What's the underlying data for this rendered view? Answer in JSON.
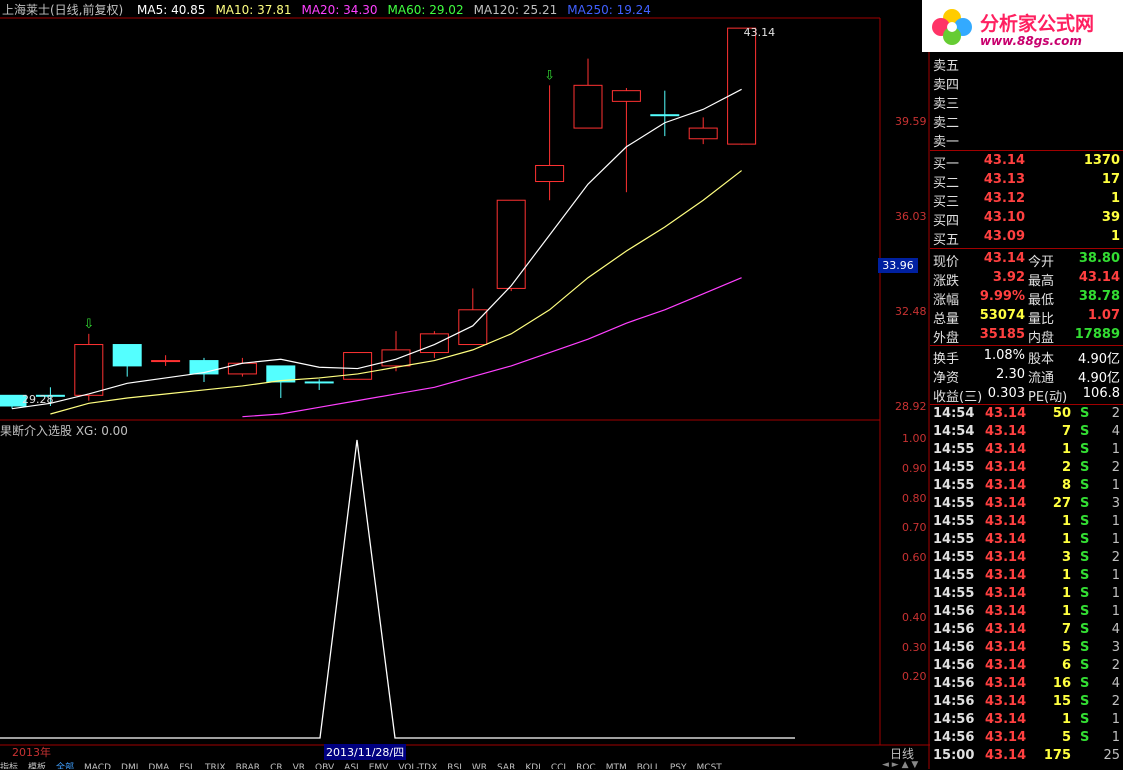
{
  "header": {
    "stock": "上海莱士(日线,前复权)",
    "ma": [
      {
        "label": "MA5: 40.85",
        "color": "#ffffff"
      },
      {
        "label": "MA10: 37.81",
        "color": "#ffff80"
      },
      {
        "label": "MA20: 34.30",
        "color": "#ff40ff"
      },
      {
        "label": "MA60: 29.02",
        "color": "#40ff40"
      },
      {
        "label": "MA120: 25.21",
        "color": "#c0c0c0"
      },
      {
        "label": "MA250: 19.24",
        "color": "#4060ff"
      }
    ]
  },
  "indicator": {
    "title": "果断介入选股 XG: 0.00",
    "date_label": "2013/11/28/四",
    "year_label": "2013年",
    "period": "日线"
  },
  "chart_data": [
    {
      "type": "candlestick",
      "title": "上海莱士(日线,前复权)",
      "yticks": [
        39.59,
        36.03,
        32.48,
        28.92
      ],
      "current_price_tag": 33.96,
      "annotations": [
        {
          "text": "43.14"
        },
        {
          "text": "29.28"
        }
      ],
      "candles": [
        {
          "o": 29.4,
          "c": 29.0,
          "h": 29.4,
          "l": 28.9,
          "up": false
        },
        {
          "o": 29.4,
          "c": 29.4,
          "h": 29.7,
          "l": 29.0,
          "up": false
        },
        {
          "o": 29.4,
          "c": 31.3,
          "h": 31.7,
          "l": 29.2,
          "up": true
        },
        {
          "o": 31.3,
          "c": 30.5,
          "h": 31.3,
          "l": 30.1,
          "up": false
        },
        {
          "o": 30.7,
          "c": 30.7,
          "h": 30.9,
          "l": 30.5,
          "up": true
        },
        {
          "o": 30.7,
          "c": 30.2,
          "h": 30.8,
          "l": 29.9,
          "up": false
        },
        {
          "o": 30.2,
          "c": 30.6,
          "h": 30.8,
          "l": 30.1,
          "up": true
        },
        {
          "o": 30.5,
          "c": 29.9,
          "h": 30.5,
          "l": 29.3,
          "up": false
        },
        {
          "o": 29.9,
          "c": 29.9,
          "h": 30.0,
          "l": 29.6,
          "up": false
        },
        {
          "o": 30.0,
          "c": 31.0,
          "h": 31.0,
          "l": 30.0,
          "up": true
        },
        {
          "o": 30.5,
          "c": 31.1,
          "h": 31.8,
          "l": 30.3,
          "up": true
        },
        {
          "o": 31.0,
          "c": 31.7,
          "h": 31.8,
          "l": 30.8,
          "up": true
        },
        {
          "o": 31.3,
          "c": 32.6,
          "h": 33.4,
          "l": 31.3,
          "up": true
        },
        {
          "o": 33.4,
          "c": 36.7,
          "h": 36.7,
          "l": 33.3,
          "up": true
        },
        {
          "o": 37.4,
          "c": 38.0,
          "h": 41.0,
          "l": 36.7,
          "up": true
        },
        {
          "o": 39.4,
          "c": 41.0,
          "h": 42.0,
          "l": 39.4,
          "up": true
        },
        {
          "o": 40.4,
          "c": 40.8,
          "h": 40.9,
          "l": 37.0,
          "up": true
        },
        {
          "o": 39.9,
          "c": 39.9,
          "h": 40.8,
          "l": 39.1,
          "up": false
        },
        {
          "o": 39.4,
          "c": 39.0,
          "h": 39.8,
          "l": 38.8,
          "up": true
        },
        {
          "o": 38.8,
          "c": 43.14,
          "h": 43.14,
          "l": 38.78,
          "up": true
        }
      ],
      "signals": [
        2,
        14
      ],
      "ma5": [
        28.9,
        29.1,
        29.45,
        29.85,
        30.05,
        30.25,
        30.6,
        30.75,
        30.45,
        30.4,
        30.75,
        31.3,
        32.0,
        33.5,
        35.4,
        37.3,
        38.7,
        39.6,
        40.1,
        40.85
      ],
      "ma10": [
        null,
        28.7,
        29.1,
        29.3,
        29.45,
        29.6,
        29.75,
        29.95,
        30.05,
        30.2,
        30.45,
        30.7,
        31.1,
        31.7,
        32.6,
        33.8,
        34.8,
        35.7,
        36.7,
        37.81
      ],
      "ma20": [
        null,
        null,
        null,
        null,
        null,
        null,
        28.6,
        28.7,
        28.95,
        29.2,
        29.45,
        29.7,
        30.1,
        30.5,
        31.0,
        31.5,
        32.1,
        32.6,
        33.2,
        33.8
      ]
    },
    {
      "type": "line",
      "title": "果断介入选股 XG: 0.00",
      "yticks": [
        1.0,
        0.9,
        0.8,
        0.7,
        0.6,
        0.4,
        0.3,
        0.2
      ],
      "series": [
        {
          "values": [
            0,
            0,
            0,
            0,
            0,
            0,
            0,
            0,
            1,
            0,
            0,
            0,
            0,
            0,
            0,
            0,
            0,
            0,
            0,
            0
          ]
        }
      ]
    }
  ],
  "bottom_tabs": [
    "指标",
    "模板",
    "全部",
    "MACD",
    "DMI",
    "DMA",
    "FSL",
    "TRIX",
    "BRAR",
    "CR",
    "VR",
    "OBV",
    "ASI",
    "EMV",
    "VOL-TDX",
    "RSI",
    "WR",
    "SAR",
    "KDJ",
    "CCI",
    "ROC",
    "MTM",
    "BOLL",
    "PSY",
    "MCST"
  ],
  "quote": {
    "sell": [
      {
        "label": "卖五",
        "price": "",
        "vol": ""
      },
      {
        "label": "卖四",
        "price": "",
        "vol": ""
      },
      {
        "label": "卖三",
        "price": "",
        "vol": ""
      },
      {
        "label": "卖二",
        "price": "",
        "vol": ""
      },
      {
        "label": "卖一",
        "price": "",
        "vol": ""
      }
    ],
    "buy": [
      {
        "label": "买一",
        "price": "43.14",
        "vol": "1370"
      },
      {
        "label": "买二",
        "price": "43.13",
        "vol": "17"
      },
      {
        "label": "买三",
        "price": "43.12",
        "vol": "1"
      },
      {
        "label": "买四",
        "price": "43.10",
        "vol": "39"
      },
      {
        "label": "买五",
        "price": "43.09",
        "vol": "1"
      }
    ],
    "stats": [
      {
        "l1": "现价",
        "v1": "43.14",
        "c1": "red",
        "l2": "今开",
        "v2": "38.80",
        "c2": "green"
      },
      {
        "l1": "涨跌",
        "v1": "3.92",
        "c1": "red",
        "l2": "最高",
        "v2": "43.14",
        "c2": "red"
      },
      {
        "l1": "涨幅",
        "v1": "9.99%",
        "c1": "red",
        "l2": "最低",
        "v2": "38.78",
        "c2": "green"
      },
      {
        "l1": "总量",
        "v1": "53074",
        "c1": "yellow",
        "l2": "量比",
        "v2": "1.07",
        "c2": "red"
      },
      {
        "l1": "外盘",
        "v1": "35185",
        "c1": "red",
        "l2": "内盘",
        "v2": "17889",
        "c2": "green"
      }
    ],
    "stats2": [
      {
        "l1": "换手",
        "v1": "1.08%",
        "l2": "股本",
        "v2": "4.90亿"
      },
      {
        "l1": "净资",
        "v1": "2.30",
        "l2": "流通",
        "v2": "4.90亿"
      },
      {
        "l1": "收益(三)",
        "v1": "0.303",
        "l2": "PE(动)",
        "v2": "106.8"
      }
    ]
  },
  "trades": [
    {
      "t": "14:54",
      "p": "43.14",
      "v": "50",
      "s": "S",
      "n": "2"
    },
    {
      "t": "14:54",
      "p": "43.14",
      "v": "7",
      "s": "S",
      "n": "4"
    },
    {
      "t": "14:55",
      "p": "43.14",
      "v": "1",
      "s": "S",
      "n": "1"
    },
    {
      "t": "14:55",
      "p": "43.14",
      "v": "2",
      "s": "S",
      "n": "2"
    },
    {
      "t": "14:55",
      "p": "43.14",
      "v": "8",
      "s": "S",
      "n": "1"
    },
    {
      "t": "14:55",
      "p": "43.14",
      "v": "27",
      "s": "S",
      "n": "3"
    },
    {
      "t": "14:55",
      "p": "43.14",
      "v": "1",
      "s": "S",
      "n": "1"
    },
    {
      "t": "14:55",
      "p": "43.14",
      "v": "1",
      "s": "S",
      "n": "1"
    },
    {
      "t": "14:55",
      "p": "43.14",
      "v": "3",
      "s": "S",
      "n": "2"
    },
    {
      "t": "14:55",
      "p": "43.14",
      "v": "1",
      "s": "S",
      "n": "1"
    },
    {
      "t": "14:55",
      "p": "43.14",
      "v": "1",
      "s": "S",
      "n": "1"
    },
    {
      "t": "14:56",
      "p": "43.14",
      "v": "1",
      "s": "S",
      "n": "1"
    },
    {
      "t": "14:56",
      "p": "43.14",
      "v": "7",
      "s": "S",
      "n": "4"
    },
    {
      "t": "14:56",
      "p": "43.14",
      "v": "5",
      "s": "S",
      "n": "3"
    },
    {
      "t": "14:56",
      "p": "43.14",
      "v": "6",
      "s": "S",
      "n": "2"
    },
    {
      "t": "14:56",
      "p": "43.14",
      "v": "16",
      "s": "S",
      "n": "4"
    },
    {
      "t": "14:56",
      "p": "43.14",
      "v": "15",
      "s": "S",
      "n": "2"
    },
    {
      "t": "14:56",
      "p": "43.14",
      "v": "1",
      "s": "S",
      "n": "1"
    },
    {
      "t": "14:56",
      "p": "43.14",
      "v": "5",
      "s": "S",
      "n": "1"
    },
    {
      "t": "15:00",
      "p": "43.14",
      "v": "175",
      "s": "",
      "n": "25"
    }
  ],
  "logo": {
    "text": "分析家公式网",
    "url": "www.88gs.com"
  }
}
